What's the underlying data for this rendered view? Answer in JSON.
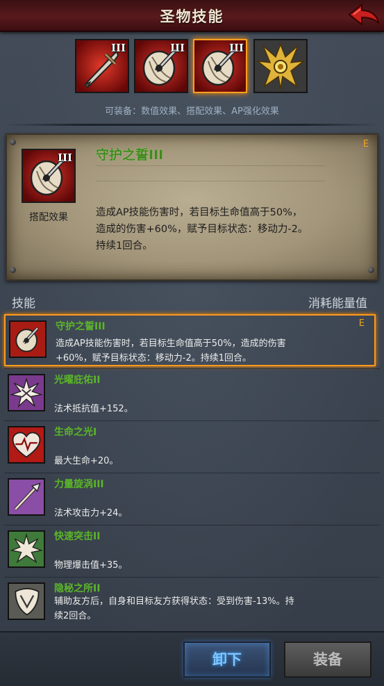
{
  "header": {
    "title": "圣物技能"
  },
  "slots": [
    {
      "roman": "III",
      "icon": "sword-icon",
      "selected": false
    },
    {
      "roman": "III",
      "icon": "shield-sword-icon",
      "selected": false
    },
    {
      "roman": "III",
      "icon": "shield-sword-icon",
      "selected": true
    },
    {
      "roman": "",
      "icon": "golden-crest-icon",
      "selected": false
    }
  ],
  "equip_hint": "可装备：数值效果、搭配效果、AP强化效果",
  "detail": {
    "roman": "III",
    "type": "搭配效果",
    "name": "守护之誓III",
    "rank": "E",
    "desc": [
      "造成AP技能伤害时，若目标生命值高于50%，",
      "造成的伤害+60%，赋予目标状态：移动力-2。",
      "持续1回合。"
    ]
  },
  "list_header": {
    "left": "技能",
    "right": "消耗能量值"
  },
  "skills": [
    {
      "name": "守护之誓III",
      "rank": "E",
      "icon": "shield-sword-icon",
      "desc": [
        "造成AP技能伤害时，若目标生命值高于50%，造成的伤害",
        "+60%，赋予目标状态：移动力-2。持续1回合。"
      ],
      "selected": true
    },
    {
      "name": "光曜庇佑II",
      "rank": "",
      "icon": "burst-icon",
      "desc": [
        "法术抵抗值+152。"
      ],
      "selected": false
    },
    {
      "name": "生命之光I",
      "rank": "",
      "icon": "heart-icon",
      "desc": [
        "最大生命+20。"
      ],
      "selected": false
    },
    {
      "name": "力量旋涡III",
      "rank": "",
      "icon": "spear-icon",
      "desc": [
        "法术攻击力+24。"
      ],
      "selected": false
    },
    {
      "name": "快速突击II",
      "rank": "",
      "icon": "star-burst-icon",
      "desc": [
        "物理爆击值+35。"
      ],
      "selected": false
    },
    {
      "name": "隐秘之所II",
      "rank": "",
      "icon": "hidden-shield-icon",
      "desc": [
        "辅助友方后，自身和目标友方获得状态：受到伤害-13%。持",
        "续2回合。"
      ],
      "selected": false
    }
  ],
  "buttons": {
    "unequip": "卸下",
    "equip": "装备"
  },
  "colors": {
    "header": "#5a1a1d",
    "accent": "#ff9a1e",
    "skill_name": "#5cb52a",
    "rank": "#f0a020"
  }
}
